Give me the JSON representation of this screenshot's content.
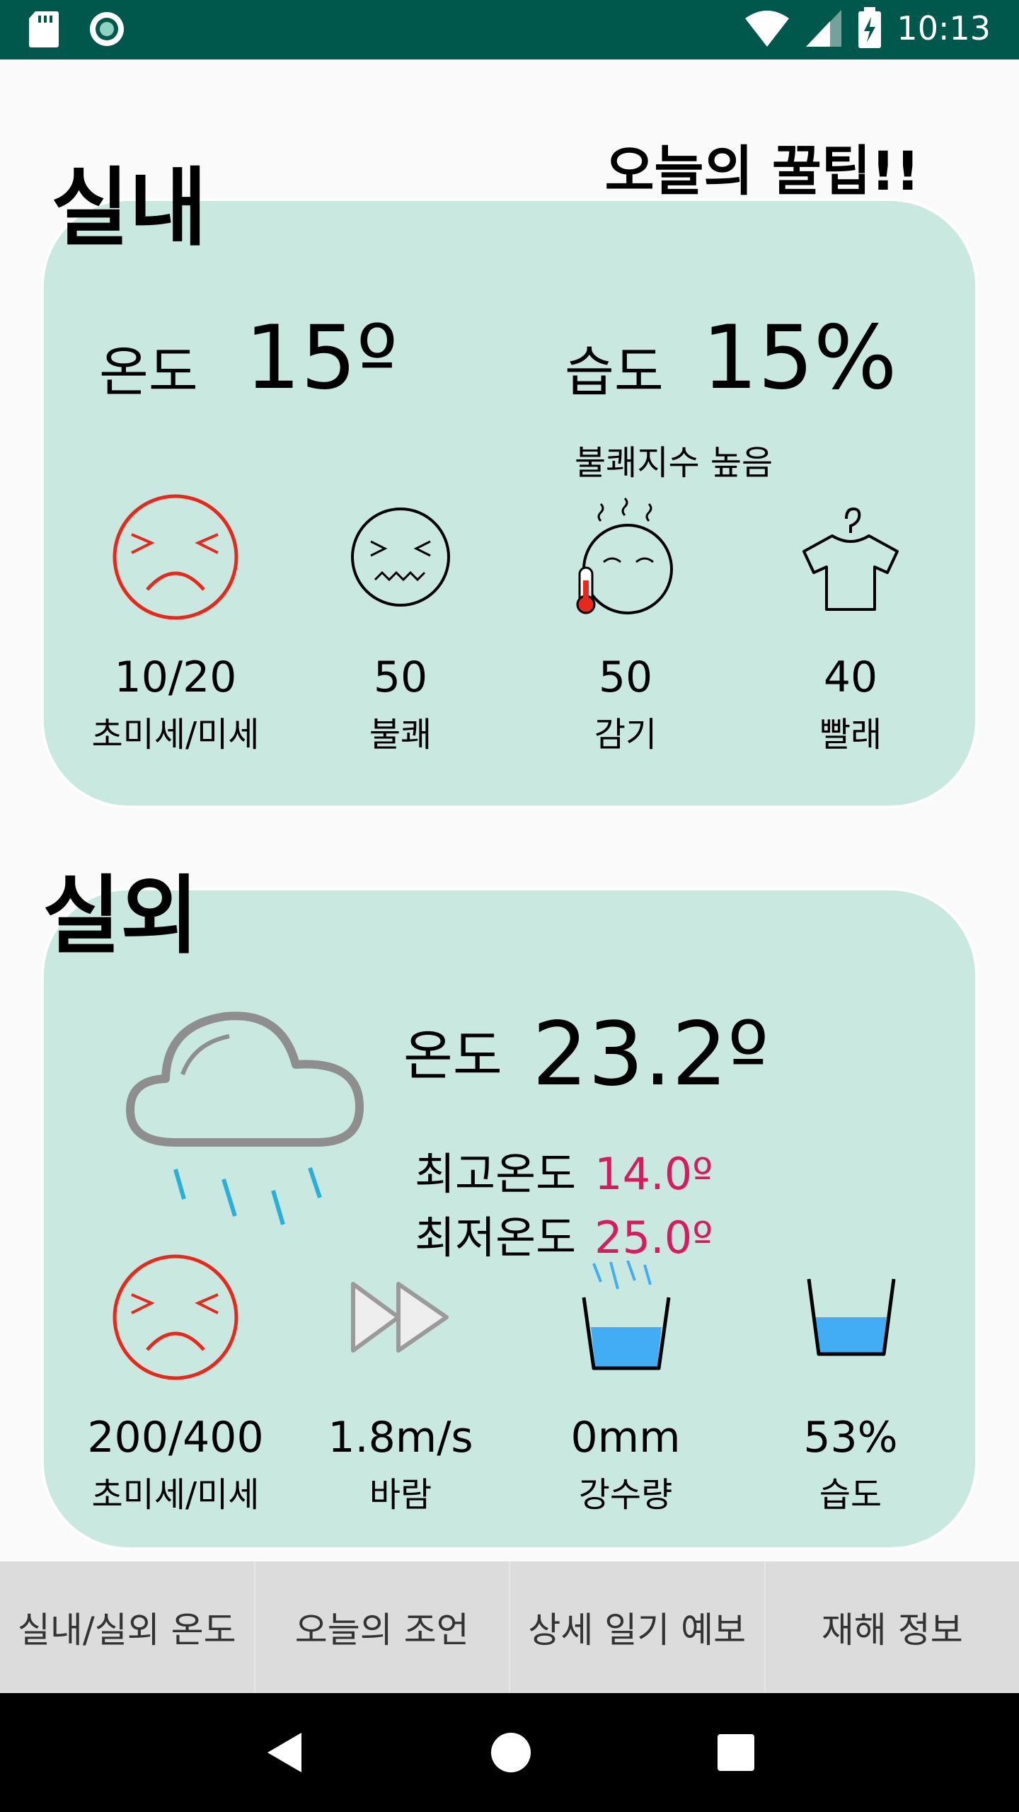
{
  "status_bar": {
    "time": "10:13",
    "icons": [
      "sd-card-icon",
      "record-icon",
      "wifi-icon",
      "signal-icon",
      "battery-charging-icon"
    ]
  },
  "header": {
    "indoor_title": "실내",
    "tip_title": "오늘의 꿀팁!!"
  },
  "indoor": {
    "temp_label": "온도",
    "temp_value": "15º",
    "humidity_label": "습도",
    "humidity_value": "15%",
    "discomfort_text": "불쾌지수 높음",
    "metrics": [
      {
        "value": "10/20",
        "label": "초미세/미세",
        "icon": "angry-face-icon"
      },
      {
        "value": "50",
        "label": "불쾌",
        "icon": "uncomfortable-face-icon"
      },
      {
        "value": "50",
        "label": "감기",
        "icon": "sick-face-icon"
      },
      {
        "value": "40",
        "label": "빨래",
        "icon": "shirt-on-hanger-icon"
      }
    ]
  },
  "outdoor": {
    "title": "실외",
    "temp_label": "온도",
    "temp_value": "23.2º",
    "high_label": "최고온도",
    "high_value": "14.0º",
    "low_label": "최저온도",
    "low_value": "25.0º",
    "metrics": [
      {
        "value": "200/400",
        "label": "초미세/미세",
        "icon": "angry-face-icon"
      },
      {
        "value": "1.8m/s",
        "label": "바람",
        "icon": "fast-forward-icon"
      },
      {
        "value": "0mm",
        "label": "강수량",
        "icon": "rain-cup-icon"
      },
      {
        "value": "53%",
        "label": "습도",
        "icon": "water-cup-icon"
      }
    ]
  },
  "tabs": [
    "실내/실외 온도",
    "오늘의 조언",
    "상세 일기 예보",
    "재해 정보"
  ],
  "colors": {
    "status_bar": "#00574b",
    "card": "#c8e8e0",
    "accent_pink": "#d81b60",
    "angry_red": "#e8281a",
    "rain_blue": "#2ab0d8",
    "water_blue": "#42adf5"
  }
}
